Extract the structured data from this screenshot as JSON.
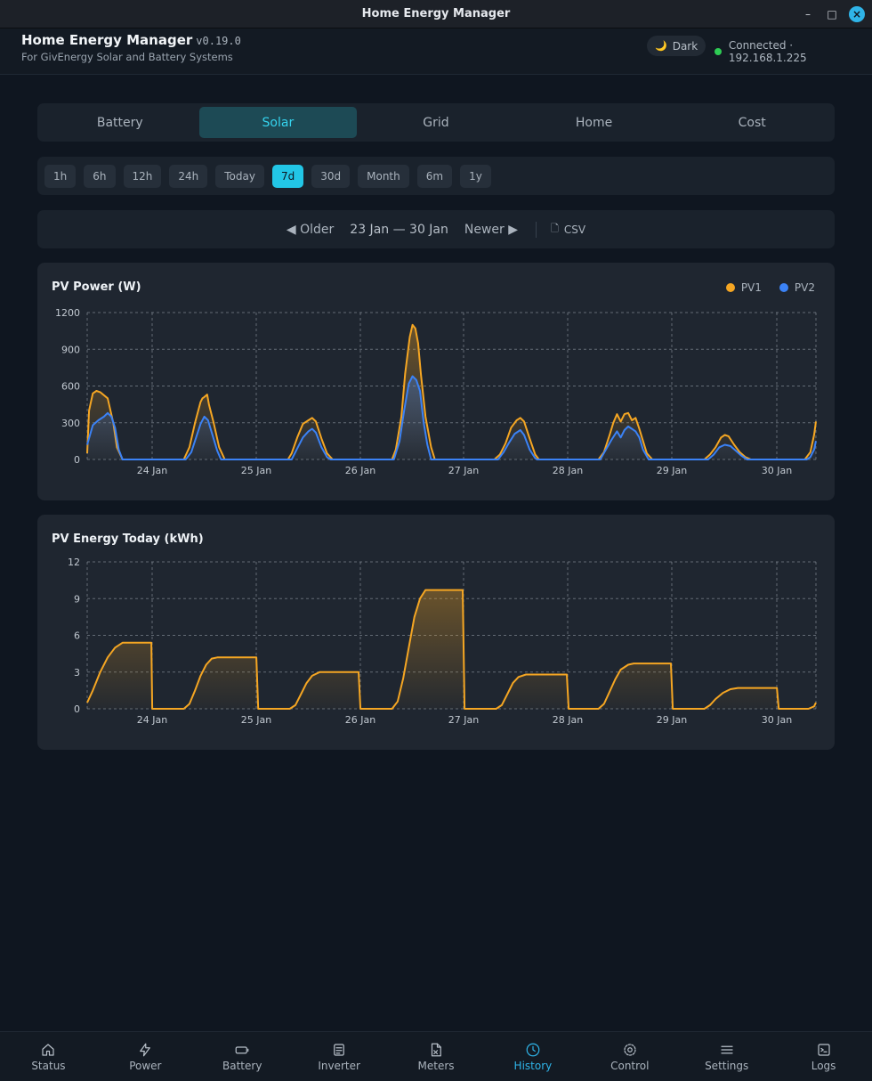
{
  "window": {
    "title": "Home Energy Manager",
    "minimize": "–",
    "maximize": "□",
    "close": "×"
  },
  "header": {
    "app_name": "Home Energy Manager",
    "version": "v0.19.0",
    "subtitle": "For GivEnergy Solar and Battery Systems",
    "theme_label": "Dark",
    "connection": "Connected · 192.168.1.225",
    "status_color": "#2ecc54"
  },
  "tabs": [
    {
      "label": "Battery"
    },
    {
      "label": "Solar",
      "active": true
    },
    {
      "label": "Grid"
    },
    {
      "label": "Home"
    },
    {
      "label": "Cost"
    }
  ],
  "ranges": [
    {
      "label": "1h"
    },
    {
      "label": "6h"
    },
    {
      "label": "12h"
    },
    {
      "label": "24h"
    },
    {
      "label": "Today"
    },
    {
      "label": "7d",
      "active": true
    },
    {
      "label": "30d"
    },
    {
      "label": "Month"
    },
    {
      "label": "6m"
    },
    {
      "label": "1y"
    }
  ],
  "navigation": {
    "older": "◀ Older",
    "range": "23 Jan — 30 Jan",
    "newer": "Newer ▶",
    "csv": "CSV"
  },
  "chart_data": [
    {
      "type": "area",
      "title": "PV Power (W)",
      "ylim": [
        0,
        1200
      ],
      "yticks": [
        0,
        300,
        600,
        900,
        1200
      ],
      "x_tick_labels": [
        "24 Jan",
        "25 Jan",
        "26 Jan",
        "27 Jan",
        "28 Jan",
        "29 Jan",
        "30 Jan"
      ],
      "legend": "top-right",
      "grid": true,
      "series": [
        {
          "name": "PV1",
          "color": "#f5a623",
          "points": [
            [
              0,
              50
            ],
            [
              0.1,
              400
            ],
            [
              0.3,
              540
            ],
            [
              0.5,
              560
            ],
            [
              0.7,
              550
            ],
            [
              1.1,
              500
            ],
            [
              1.4,
              300
            ],
            [
              1.6,
              100
            ],
            [
              1.9,
              0
            ],
            [
              5.2,
              0
            ],
            [
              5.5,
              100
            ],
            [
              5.8,
              300
            ],
            [
              6.1,
              470
            ],
            [
              6.2,
              500
            ],
            [
              6.3,
              510
            ],
            [
              6.45,
              530
            ],
            [
              6.55,
              450
            ],
            [
              6.8,
              300
            ],
            [
              7.1,
              100
            ],
            [
              7.4,
              0
            ],
            [
              10.8,
              0
            ],
            [
              11,
              50
            ],
            [
              11.3,
              180
            ],
            [
              11.6,
              290
            ],
            [
              11.9,
              320
            ],
            [
              12.1,
              340
            ],
            [
              12.3,
              310
            ],
            [
              12.6,
              170
            ],
            [
              12.9,
              50
            ],
            [
              13.2,
              0
            ],
            [
              16.4,
              0
            ],
            [
              16.6,
              80
            ],
            [
              16.9,
              350
            ],
            [
              17.1,
              700
            ],
            [
              17.35,
              1000
            ],
            [
              17.5,
              1100
            ],
            [
              17.65,
              1070
            ],
            [
              17.8,
              950
            ],
            [
              17.95,
              700
            ],
            [
              18.2,
              350
            ],
            [
              18.5,
              100
            ],
            [
              18.7,
              0
            ],
            [
              21.9,
              0
            ],
            [
              22.2,
              40
            ],
            [
              22.5,
              130
            ],
            [
              22.8,
              260
            ],
            [
              23.1,
              320
            ],
            [
              23.3,
              340
            ],
            [
              23.5,
              310
            ],
            [
              23.8,
              170
            ],
            [
              24.1,
              40
            ],
            [
              24.3,
              0
            ],
            [
              27.5,
              0
            ],
            [
              27.8,
              60
            ],
            [
              28.1,
              200
            ],
            [
              28.3,
              300
            ],
            [
              28.5,
              370
            ],
            [
              28.7,
              310
            ],
            [
              28.9,
              370
            ],
            [
              29.1,
              380
            ],
            [
              29.3,
              320
            ],
            [
              29.5,
              340
            ],
            [
              29.7,
              250
            ],
            [
              29.9,
              150
            ],
            [
              30.1,
              50
            ],
            [
              30.4,
              0
            ],
            [
              33.2,
              0
            ],
            [
              33.5,
              40
            ],
            [
              33.8,
              100
            ],
            [
              34.1,
              180
            ],
            [
              34.3,
              200
            ],
            [
              34.5,
              190
            ],
            [
              34.8,
              120
            ],
            [
              35.1,
              60
            ],
            [
              35.4,
              20
            ],
            [
              35.7,
              0
            ],
            [
              38.6,
              0
            ],
            [
              38.9,
              60
            ],
            [
              39.1,
              200
            ],
            [
              39.2,
              310
            ]
          ]
        },
        {
          "name": "PV2",
          "color": "#3b82f6",
          "points": [
            [
              0,
              120
            ],
            [
              0.3,
              280
            ],
            [
              0.6,
              320
            ],
            [
              0.9,
              350
            ],
            [
              1.1,
              380
            ],
            [
              1.3,
              350
            ],
            [
              1.5,
              260
            ],
            [
              1.7,
              80
            ],
            [
              1.9,
              0
            ],
            [
              5.3,
              0
            ],
            [
              5.6,
              60
            ],
            [
              5.9,
              200
            ],
            [
              6.1,
              290
            ],
            [
              6.3,
              350
            ],
            [
              6.5,
              320
            ],
            [
              6.7,
              220
            ],
            [
              7,
              70
            ],
            [
              7.2,
              0
            ],
            [
              11,
              0
            ],
            [
              11.3,
              90
            ],
            [
              11.6,
              180
            ],
            [
              11.9,
              230
            ],
            [
              12.1,
              250
            ],
            [
              12.3,
              220
            ],
            [
              12.6,
              100
            ],
            [
              12.9,
              20
            ],
            [
              13.1,
              0
            ],
            [
              16.5,
              0
            ],
            [
              16.8,
              150
            ],
            [
              17.05,
              400
            ],
            [
              17.3,
              620
            ],
            [
              17.5,
              680
            ],
            [
              17.7,
              650
            ],
            [
              17.9,
              560
            ],
            [
              18.1,
              300
            ],
            [
              18.3,
              120
            ],
            [
              18.5,
              0
            ],
            [
              22.1,
              0
            ],
            [
              22.4,
              60
            ],
            [
              22.7,
              140
            ],
            [
              23,
              210
            ],
            [
              23.3,
              240
            ],
            [
              23.5,
              200
            ],
            [
              23.8,
              80
            ],
            [
              24.1,
              10
            ],
            [
              24.2,
              0
            ],
            [
              27.6,
              0
            ],
            [
              27.9,
              80
            ],
            [
              28.2,
              160
            ],
            [
              28.5,
              230
            ],
            [
              28.7,
              180
            ],
            [
              28.9,
              240
            ],
            [
              29.1,
              270
            ],
            [
              29.3,
              250
            ],
            [
              29.5,
              230
            ],
            [
              29.7,
              180
            ],
            [
              29.9,
              80
            ],
            [
              30.2,
              0
            ],
            [
              33.4,
              0
            ],
            [
              33.7,
              40
            ],
            [
              34,
              100
            ],
            [
              34.3,
              120
            ],
            [
              34.6,
              110
            ],
            [
              34.9,
              70
            ],
            [
              35.2,
              30
            ],
            [
              35.5,
              0
            ],
            [
              38.7,
              0
            ],
            [
              38.9,
              20
            ],
            [
              39.1,
              80
            ],
            [
              39.2,
              150
            ]
          ]
        }
      ]
    },
    {
      "type": "area",
      "title": "PV Energy Today (kWh)",
      "ylim": [
        0,
        12
      ],
      "yticks": [
        0,
        3,
        6,
        9,
        12
      ],
      "x_tick_labels": [
        "24 Jan",
        "25 Jan",
        "26 Jan",
        "27 Jan",
        "28 Jan",
        "29 Jan",
        "30 Jan"
      ],
      "grid": true,
      "series": [
        {
          "name": "",
          "color": "#f5a623",
          "points": [
            [
              0,
              0.5
            ],
            [
              0.3,
              1.5
            ],
            [
              0.7,
              3
            ],
            [
              1.1,
              4.2
            ],
            [
              1.5,
              5
            ],
            [
              1.9,
              5.4
            ],
            [
              2.2,
              5.4
            ],
            [
              3.45,
              5.4
            ],
            [
              3.5,
              0
            ],
            [
              5.2,
              0
            ],
            [
              5.5,
              0.4
            ],
            [
              5.8,
              1.5
            ],
            [
              6.1,
              2.7
            ],
            [
              6.4,
              3.6
            ],
            [
              6.7,
              4.1
            ],
            [
              7,
              4.2
            ],
            [
              9.1,
              4.2
            ],
            [
              9.2,
              0
            ],
            [
              10.9,
              0
            ],
            [
              11.2,
              0.3
            ],
            [
              11.5,
              1.2
            ],
            [
              11.8,
              2.1
            ],
            [
              12.1,
              2.7
            ],
            [
              12.5,
              3
            ],
            [
              14.6,
              3
            ],
            [
              14.7,
              0
            ],
            [
              16.4,
              0
            ],
            [
              16.7,
              0.6
            ],
            [
              17,
              2.5
            ],
            [
              17.3,
              5
            ],
            [
              17.6,
              7.5
            ],
            [
              17.9,
              9
            ],
            [
              18.2,
              9.7
            ],
            [
              20.2,
              9.7
            ],
            [
              20.3,
              0
            ],
            [
              22,
              0
            ],
            [
              22.3,
              0.3
            ],
            [
              22.6,
              1.2
            ],
            [
              22.9,
              2.1
            ],
            [
              23.2,
              2.6
            ],
            [
              23.6,
              2.8
            ],
            [
              25.8,
              2.8
            ],
            [
              25.9,
              0
            ],
            [
              27.5,
              0
            ],
            [
              27.8,
              0.4
            ],
            [
              28.1,
              1.4
            ],
            [
              28.4,
              2.4
            ],
            [
              28.7,
              3.2
            ],
            [
              29.1,
              3.6
            ],
            [
              29.4,
              3.7
            ],
            [
              31.4,
              3.7
            ],
            [
              31.5,
              0
            ],
            [
              33.2,
              0
            ],
            [
              33.5,
              0.3
            ],
            [
              33.8,
              0.8
            ],
            [
              34.2,
              1.3
            ],
            [
              34.6,
              1.6
            ],
            [
              35,
              1.7
            ],
            [
              37.1,
              1.7
            ],
            [
              37.2,
              0
            ],
            [
              38.8,
              0
            ],
            [
              39.1,
              0.2
            ],
            [
              39.2,
              0.5
            ]
          ]
        }
      ]
    }
  ],
  "bottom_nav": [
    {
      "label": "Status",
      "icon": "home-icon"
    },
    {
      "label": "Power",
      "icon": "bolt-icon"
    },
    {
      "label": "Battery",
      "icon": "battery-icon"
    },
    {
      "label": "Inverter",
      "icon": "document-icon"
    },
    {
      "label": "Meters",
      "icon": "meter-doc-icon"
    },
    {
      "label": "History",
      "icon": "clock-icon",
      "active": true
    },
    {
      "label": "Control",
      "icon": "gear-icon"
    },
    {
      "label": "Settings",
      "icon": "menu-icon"
    },
    {
      "label": "Logs",
      "icon": "terminal-icon"
    }
  ]
}
